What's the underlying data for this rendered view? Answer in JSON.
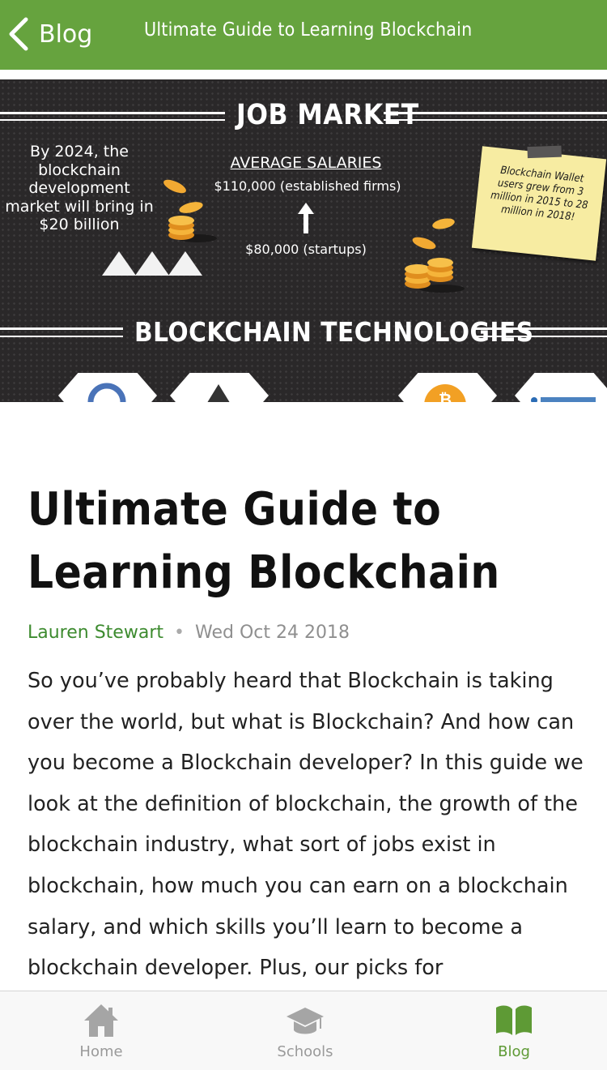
{
  "navbar": {
    "back_label": "Blog",
    "title": "Ultimate Guide to Learning Blockchain",
    "background": "#66a33e"
  },
  "hero": {
    "heading_job_market": "JOB MARKET",
    "heading_technologies": "BLOCKCHAIN TECHNOLOGIES",
    "stat_2024": "By 2024, the blockchain development market will bring in $20 billion",
    "salary_heading": "AVERAGE SALARIES",
    "salary_established": "$110,000 (established firms)",
    "salary_startups": "$80,000 (startups)",
    "sticky_note": "Blockchain Wallet users grew from 3 million in 2015 to 28 million in 2018!"
  },
  "article": {
    "title": "Ultimate Guide to Learning Blockchain",
    "author": "Lauren Stewart",
    "separator": "•",
    "date": "Wed Oct 24 2018",
    "body": "So you’ve probably heard that Blockchain is taking over the world, but what is Blockchain? And how can you become a Blockchain developer? In this guide we look at the definition of blockchain, the growth of the blockchain industry, what sort of jobs exist in blockchain, how much you can earn on a blockchain salary, and which skills you’ll learn to become a blockchain developer. Plus, our picks for"
  },
  "tabbar": {
    "items": [
      {
        "label": "Home",
        "icon": "home-icon",
        "active": false
      },
      {
        "label": "Schools",
        "icon": "graduation-cap-icon",
        "active": false
      },
      {
        "label": "Blog",
        "icon": "open-book-icon",
        "active": true
      }
    ],
    "active_color": "#5e9a35",
    "inactive_color": "#9a9a9a"
  }
}
